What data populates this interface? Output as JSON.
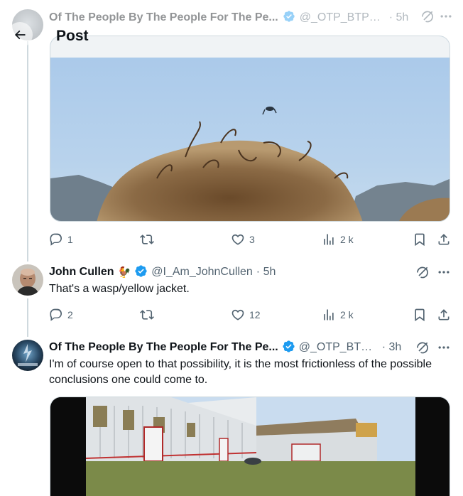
{
  "header": {
    "title": "Post",
    "ghost_name": "Of The People By The People For The Pe...",
    "ghost_handle": "@_OTP_BTP_F...",
    "ghost_time": "· 5h"
  },
  "posts": [
    {
      "stats": {
        "replies": "1",
        "likes": "3",
        "views": "2 k"
      }
    },
    {
      "name": "John Cullen",
      "emoji": "🐓",
      "handle": "@I_Am_JohnCullen",
      "time": "· 5h",
      "text": "That's a wasp/yellow jacket.",
      "stats": {
        "replies": "2",
        "likes": "12",
        "views": "2 k"
      }
    },
    {
      "name": "Of The People By The People For The Pe...",
      "handle": "@_OTP_BTP_F...",
      "time": "· 3h",
      "text": "I'm of course open to that possibility, it is the most frictionless of the possible conclusions one could come to."
    }
  ],
  "colors": {
    "text": "#0f1419",
    "secondary": "#536471",
    "verified_blue": "#1d9bf0",
    "border": "#cfd9de"
  },
  "icons": [
    "back-arrow-icon",
    "reply-icon",
    "repost-icon",
    "like-icon",
    "views-icon",
    "bookmark-icon",
    "share-icon",
    "grok-icon",
    "more-icon",
    "verified-icon"
  ]
}
